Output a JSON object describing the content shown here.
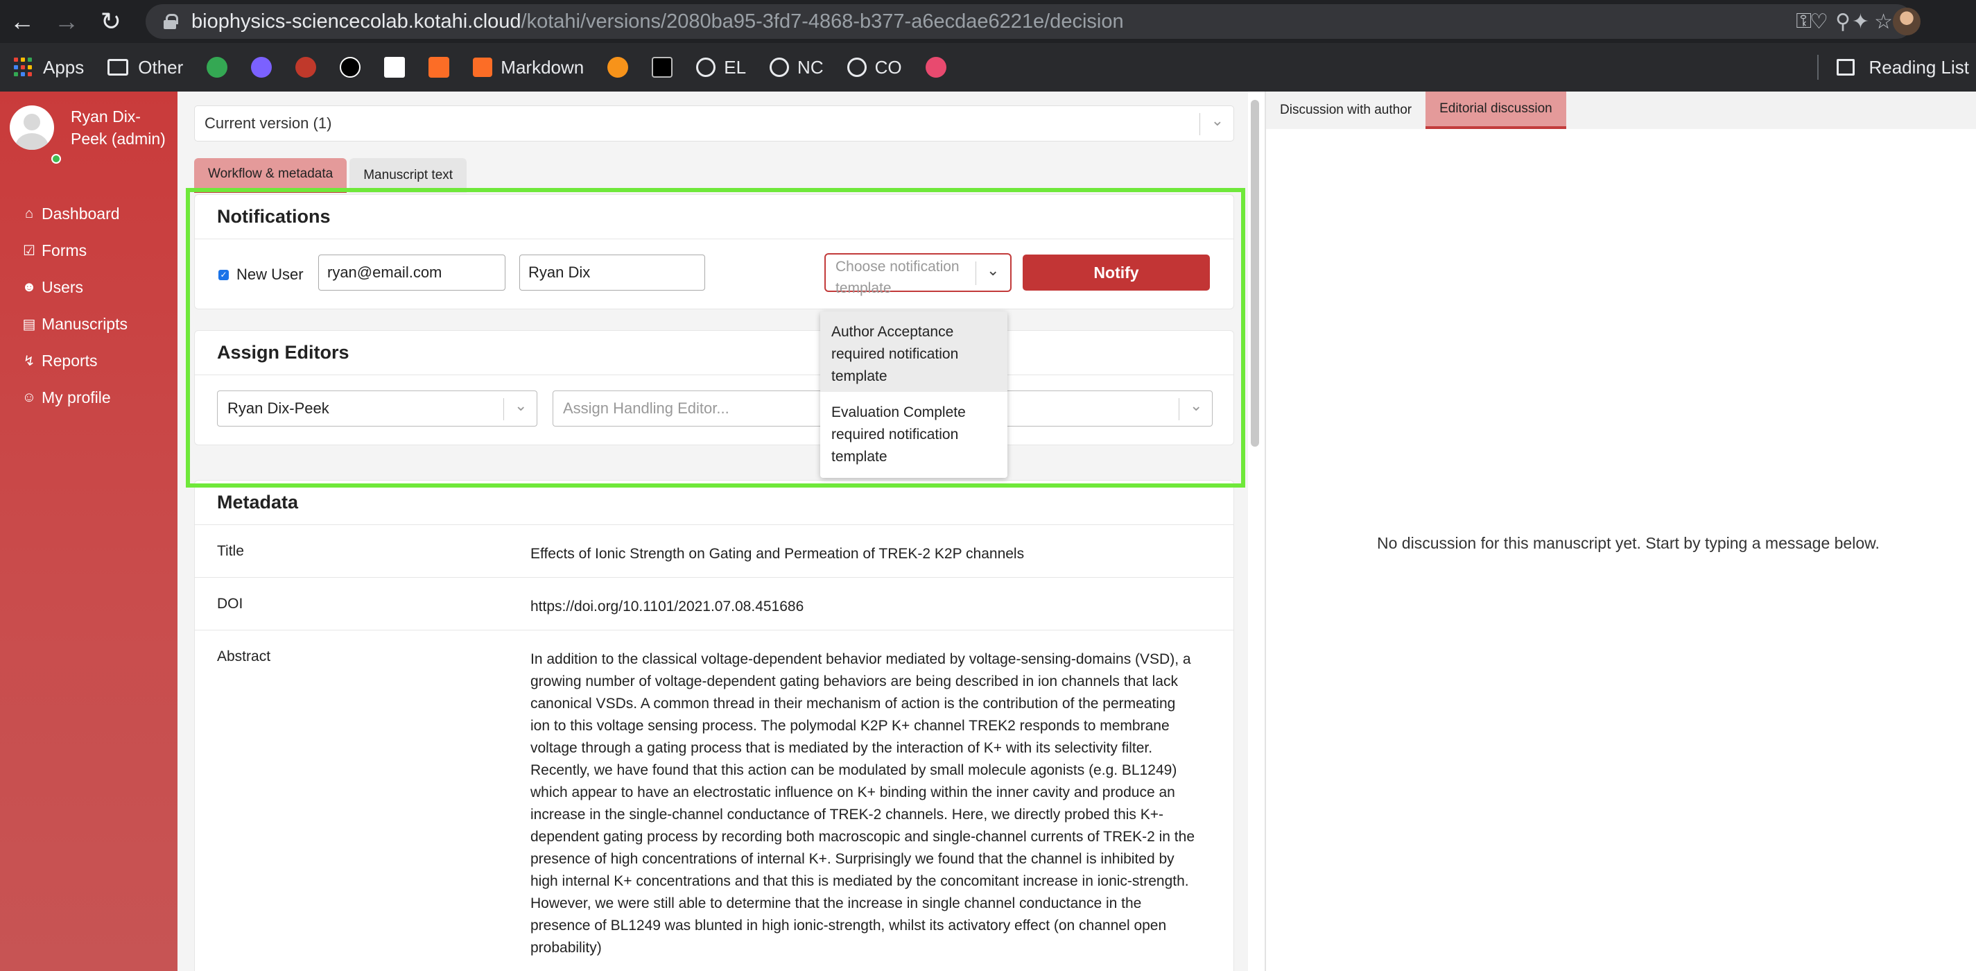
{
  "browser": {
    "url_host": "biophysics-sciencecolab.kotahi.cloud",
    "url_path": "/kotahi/versions/2080ba95-3fd7-4868-b377-a6ecdae6221e/decision",
    "bookmarks": {
      "apps": "Apps",
      "other": "Other",
      "markdown": "Markdown",
      "el": "EL",
      "nc": "NC",
      "co": "CO",
      "reading_list": "Reading List"
    }
  },
  "user": {
    "name": "Ryan Dix-Peek (admin)"
  },
  "menu": [
    {
      "label": "Dashboard",
      "icon": "home-icon"
    },
    {
      "label": "Forms",
      "icon": "check-square-icon"
    },
    {
      "label": "Users",
      "icon": "users-icon"
    },
    {
      "label": "Manuscripts",
      "icon": "file-icon"
    },
    {
      "label": "Reports",
      "icon": "activity-icon"
    },
    {
      "label": "My profile",
      "icon": "user-icon"
    }
  ],
  "version_select": {
    "value": "Current version (1)"
  },
  "tabs": {
    "workflow": "Workflow & metadata",
    "manuscript": "Manuscript text"
  },
  "notifications": {
    "title": "Notifications",
    "new_user_label": "New User",
    "new_user_checked": true,
    "email": "ryan@email.com",
    "name": "Ryan Dix",
    "template_placeholder": "Choose notification template",
    "notify_label": "Notify",
    "options": [
      "Author Acceptance required notification template",
      "Evaluation Complete required notification template"
    ]
  },
  "assign_editors": {
    "title": "Assign Editors",
    "senior_editor": "Ryan Dix-Peek",
    "handling_placeholder": "Assign Handling Editor..."
  },
  "metadata": {
    "title": "Metadata",
    "title_label": "Title",
    "title_value": "Effects of Ionic Strength on Gating and Permeation of TREK-2 K2P channels",
    "doi_label": "DOI",
    "doi_value": "https://doi.org/10.1101/2021.07.08.451686",
    "abstract_label": "Abstract",
    "abstract_value": "In addition to the classical voltage-dependent behavior mediated by voltage-sensing-domains (VSD), a growing number of voltage-dependent gating behaviors are being described in ion channels that lack canonical VSDs. A common thread in their mechanism of action is the contribution of the permeating ion to this voltage sensing process. The polymodal K2P K+ channel TREK2 responds to membrane voltage through a gating process that is mediated by the interaction of K+ with its selectivity filter. Recently, we have found that this action can be modulated by small molecule agonists (e.g. BL1249) which appear to have an electrostatic influence on K+ binding within the inner cavity and produce an increase in the single-channel conductance of TREK-2 channels. Here, we directly probed this K+-dependent gating process by recording both macroscopic and single-channel currents of TREK-2 in the presence of high concentrations of internal K+. Surprisingly we found that the channel is inhibited by high internal K+ concentrations and that this is mediated by the concomitant increase in ionic-strength. However, we were still able to determine that the increase in single channel conductance in the presence of BL1249 was blunted in high ionic-strength, whilst its activatory effect (on channel open probability)"
  },
  "discussion": {
    "tab_author": "Discussion with author",
    "tab_editorial": "Editorial discussion",
    "empty_message": "No discussion for this manuscript yet. Start by typing a message below."
  },
  "colors": {
    "brand": "#c23b3b",
    "tab_active": "#e49a9a",
    "highlight": "#6fe83a"
  }
}
